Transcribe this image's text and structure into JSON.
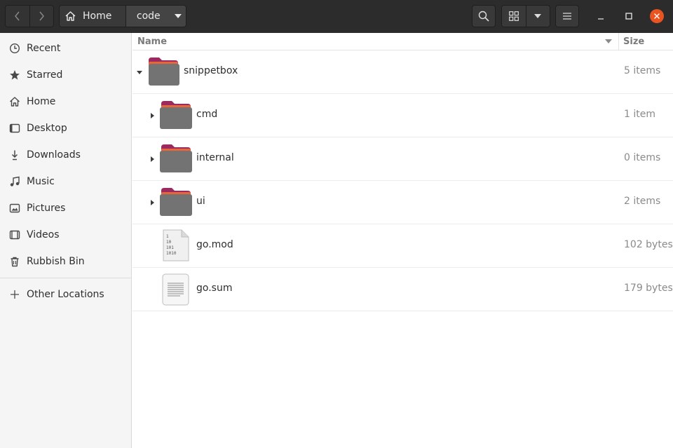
{
  "header": {
    "path": [
      {
        "label": "Home",
        "icon": "home-icon"
      },
      {
        "label": "code",
        "icon": "chevron-down-icon"
      }
    ],
    "buttons": [
      "back",
      "forward",
      "search",
      "icon-view",
      "view-options",
      "menu",
      "minimize",
      "maximize",
      "close"
    ],
    "accent_close": "#e95420"
  },
  "sidebar": {
    "items": [
      {
        "label": "Recent",
        "icon": "clock-icon"
      },
      {
        "label": "Starred",
        "icon": "star-icon"
      },
      {
        "label": "Home",
        "icon": "home-icon"
      },
      {
        "label": "Desktop",
        "icon": "desktop-icon"
      },
      {
        "label": "Downloads",
        "icon": "download-icon"
      },
      {
        "label": "Music",
        "icon": "music-note-icon"
      },
      {
        "label": "Pictures",
        "icon": "picture-icon"
      },
      {
        "label": "Videos",
        "icon": "video-icon"
      },
      {
        "label": "Rubbish Bin",
        "icon": "trash-icon"
      }
    ],
    "other": {
      "label": "Other Locations",
      "icon": "plus-icon"
    }
  },
  "columns": {
    "name": "Name",
    "size": "Size"
  },
  "files": [
    {
      "name": "snippetbox",
      "size": "5 items",
      "type": "folder",
      "expanded": true
    },
    {
      "name": "cmd",
      "size": "1 item",
      "type": "folder",
      "expanded": false
    },
    {
      "name": "internal",
      "size": "0 items",
      "type": "folder",
      "expanded": false
    },
    {
      "name": "ui",
      "size": "2 items",
      "type": "folder",
      "expanded": false
    },
    {
      "name": "go.mod",
      "size": "102 bytes",
      "type": "binary-file",
      "file_glyph": [
        "1",
        "10",
        "101",
        "1010"
      ]
    },
    {
      "name": "go.sum",
      "size": "179 bytes",
      "type": "text-file"
    }
  ]
}
